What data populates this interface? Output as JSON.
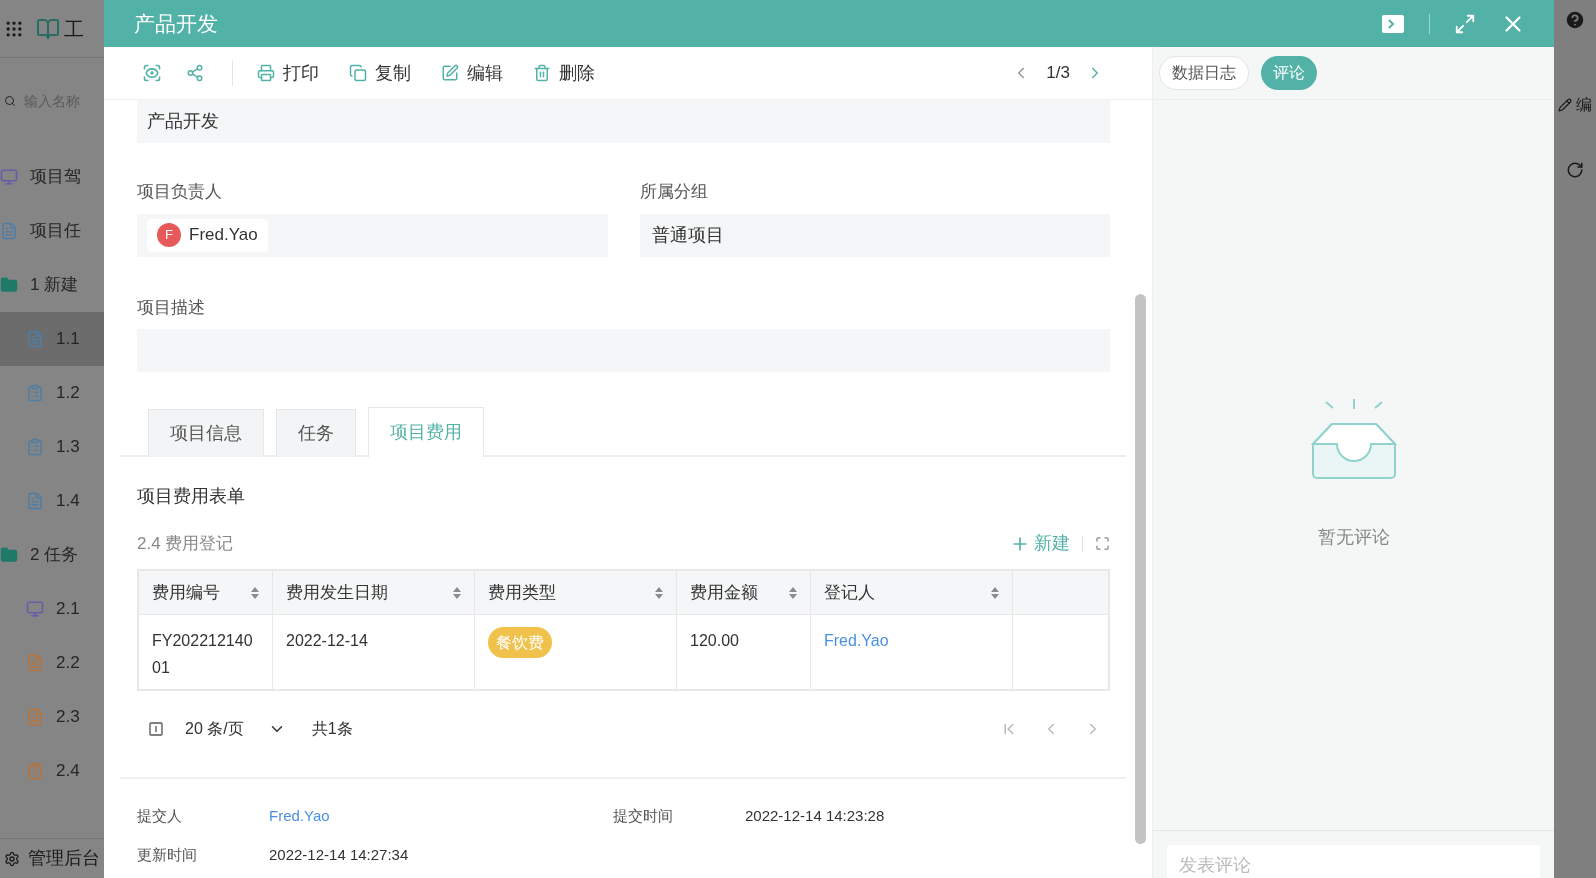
{
  "background_app": {
    "logo_text": "工",
    "search": {
      "placeholder": "输入名称"
    },
    "nav_items": [
      {
        "label": "项目驾",
        "kind": "monitor",
        "color": "#6a5aa8",
        "selected": false
      },
      {
        "label": "项目任",
        "kind": "doc",
        "color": "#4d7ea8",
        "selected": false
      },
      {
        "label": "1 新建",
        "kind": "folder",
        "color": "#1f7a6a",
        "selected": false,
        "children": [
          {
            "label": "1.1",
            "kind": "doc",
            "color": "#4d7ea8",
            "selected": true
          },
          {
            "label": "1.2",
            "kind": "board",
            "color": "#4d7ea8",
            "selected": false
          },
          {
            "label": "1.3",
            "kind": "board",
            "color": "#4d7ea8",
            "selected": false
          },
          {
            "label": "1.4",
            "kind": "doc",
            "color": "#4d7ea8",
            "selected": false
          }
        ]
      },
      {
        "label": "2 任务",
        "kind": "folder",
        "color": "#1f7a6a",
        "selected": false,
        "children": [
          {
            "label": "2.1",
            "kind": "monitor",
            "color": "#6a5aa8",
            "selected": false
          },
          {
            "label": "2.2",
            "kind": "doc",
            "color": "#b8743a",
            "selected": false
          },
          {
            "label": "2.3",
            "kind": "doc",
            "color": "#b8743a",
            "selected": false
          },
          {
            "label": "2.4",
            "kind": "board",
            "color": "#b8743a",
            "selected": false
          }
        ]
      }
    ],
    "footer": "管理后台",
    "right_edge_text": "编"
  },
  "modal": {
    "title": "产品开发",
    "toolbar": {
      "actions": [
        {
          "label": "打印",
          "kind": "print"
        },
        {
          "label": "复制",
          "kind": "copy"
        },
        {
          "label": "编辑",
          "kind": "edit"
        },
        {
          "label": "删除",
          "kind": "delete"
        }
      ],
      "pager": "1/3"
    },
    "top_field_value": "产品开发",
    "fields": [
      {
        "label": "项目负责人",
        "kind": "user",
        "avatar": "F",
        "value": "Fred.Yao"
      },
      {
        "label": "所属分组",
        "kind": "text",
        "value": "普通项目"
      }
    ],
    "description": {
      "label": "项目描述"
    },
    "tabs": [
      {
        "label": "项目信息",
        "selected": false
      },
      {
        "label": "任务",
        "selected": false
      },
      {
        "label": "项目费用",
        "selected": true
      }
    ],
    "section_title": "项目费用表单",
    "subtable": {
      "title": "2.4 费用登记",
      "add_label": "新建",
      "columns": [
        "费用编号",
        "费用发生日期",
        "费用类型",
        "费用金额",
        "登记人"
      ],
      "rows": [
        {
          "cells": [
            {
              "kind": "text",
              "text": "FY20221214001"
            },
            {
              "kind": "text",
              "text": "2022-12-14"
            },
            {
              "kind": "tag",
              "text": "餐饮费",
              "color": "#f0c14b"
            },
            {
              "kind": "text",
              "text": "120.00"
            },
            {
              "kind": "link",
              "text": "Fred.Yao"
            }
          ]
        }
      ]
    },
    "pagination": {
      "page_size": "20 条/页",
      "total": "共1条"
    },
    "meta": [
      {
        "label": "提交人",
        "kind": "link",
        "value": "Fred.Yao"
      },
      {
        "label": "提交时间",
        "kind": "text",
        "value": "2022-12-14 14:23:28"
      },
      {
        "label": "更新时间",
        "kind": "text",
        "value": "2022-12-14 14:27:34"
      }
    ]
  },
  "side_panel": {
    "tabs": [
      {
        "label": "数据日志",
        "selected": false
      },
      {
        "label": "评论",
        "selected": true
      }
    ],
    "empty_text": "暂无评论",
    "comment_input": {
      "placeholder": "发表评论"
    }
  }
}
